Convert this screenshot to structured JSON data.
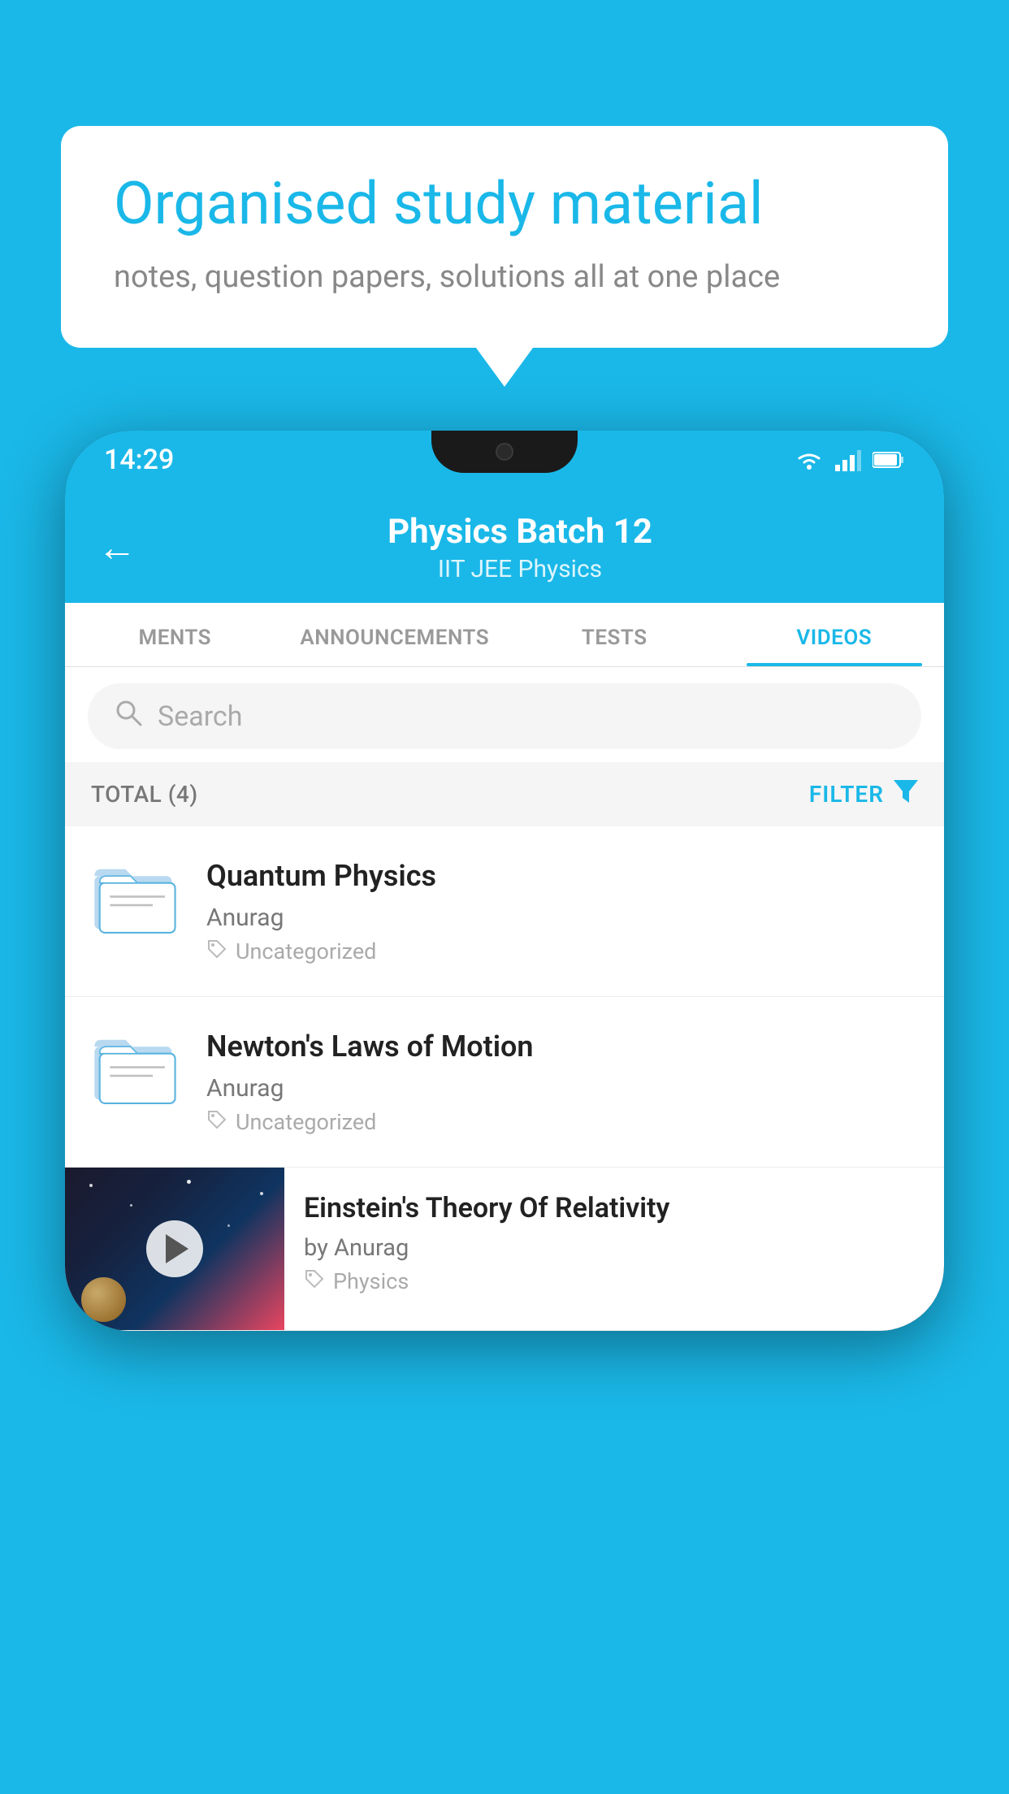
{
  "background_color": "#1ab8e8",
  "speech_bubble": {
    "title": "Organised study material",
    "subtitle": "notes, question papers, solutions all at one place"
  },
  "status_bar": {
    "time": "14:29",
    "icons": [
      "wifi",
      "signal",
      "battery"
    ]
  },
  "app_header": {
    "back_label": "←",
    "title": "Physics Batch 12",
    "subtitle": "IIT JEE   Physics"
  },
  "tabs": [
    {
      "label": "MENTS",
      "active": false
    },
    {
      "label": "ANNOUNCEMENTS",
      "active": false
    },
    {
      "label": "TESTS",
      "active": false
    },
    {
      "label": "VIDEOS",
      "active": true
    }
  ],
  "search": {
    "placeholder": "Search"
  },
  "filter_row": {
    "total_label": "TOTAL (4)",
    "filter_label": "FILTER"
  },
  "videos": [
    {
      "id": 1,
      "title": "Quantum Physics",
      "author": "Anurag",
      "tag": "Uncategorized",
      "type": "folder"
    },
    {
      "id": 2,
      "title": "Newton's Laws of Motion",
      "author": "Anurag",
      "tag": "Uncategorized",
      "type": "folder"
    },
    {
      "id": 3,
      "title": "Einstein's Theory Of Relativity",
      "author": "by Anurag",
      "tag": "Physics",
      "type": "video"
    }
  ]
}
